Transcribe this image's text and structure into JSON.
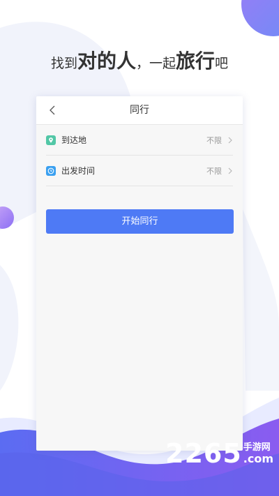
{
  "slogan": {
    "part1": "找到",
    "part2": "对的人",
    "part3": "，一起",
    "part4": "旅行",
    "part5": "吧"
  },
  "nav": {
    "back_icon": "chevron-left-icon",
    "title": "同行"
  },
  "rows": [
    {
      "label": "到达地",
      "value": "不限",
      "icon": "location-pin-icon",
      "icon_color": "#52c7a6"
    },
    {
      "label": "出发时间",
      "value": "不限",
      "icon": "clock-icon",
      "icon_color": "#3aa0f0"
    }
  ],
  "start_button": {
    "label": "开始同行",
    "color": "#4e7af5"
  },
  "watermark": {
    "number": "2265",
    "site_cn": "手游网",
    "site_en": ".com"
  },
  "colors": {
    "accent_purple": "#6f5ef0",
    "accent_blue": "#4e7af5",
    "bg_wave": "#edf0fb"
  }
}
